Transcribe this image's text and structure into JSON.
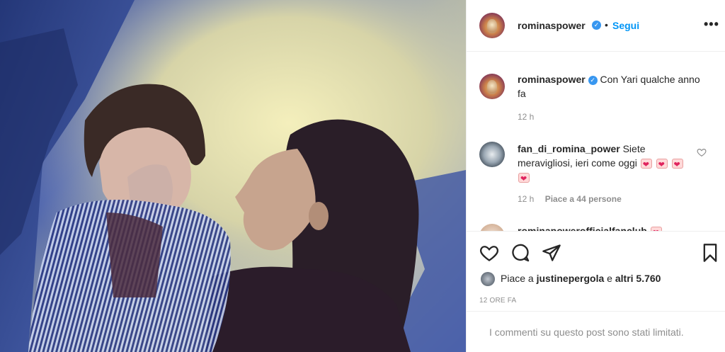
{
  "header": {
    "username": "rominaspower",
    "separator": "•",
    "follow_label": "Segui",
    "more_label": "•••"
  },
  "caption": {
    "username": "rominaspower",
    "text": "Con Yari qualche anno fa",
    "time": "12 h"
  },
  "comments": [
    {
      "username": "fan_di_romina_power",
      "text": "Siete meravigliosi, ieri come oggi",
      "time": "12 h",
      "likes": "Piace a 44 persone"
    },
    {
      "username": "rominapowerofficialfanclub"
    }
  ],
  "actions": {
    "likes_prefix": "Piace a",
    "likes_user": "justinepergola",
    "likes_middle": "e",
    "likes_others": "altri 5.760",
    "timestamp": "12 ORE FA"
  },
  "limited_notice": "I commenti su questo post sono stati limitati.",
  "icons": {
    "verified": "verified-badge-icon",
    "like": "heart-icon",
    "comment": "comment-icon",
    "share": "share-icon",
    "save": "bookmark-icon"
  },
  "colors": {
    "follow": "#0095f6",
    "verified": "#3897f0",
    "muted": "#8e8e8e"
  }
}
